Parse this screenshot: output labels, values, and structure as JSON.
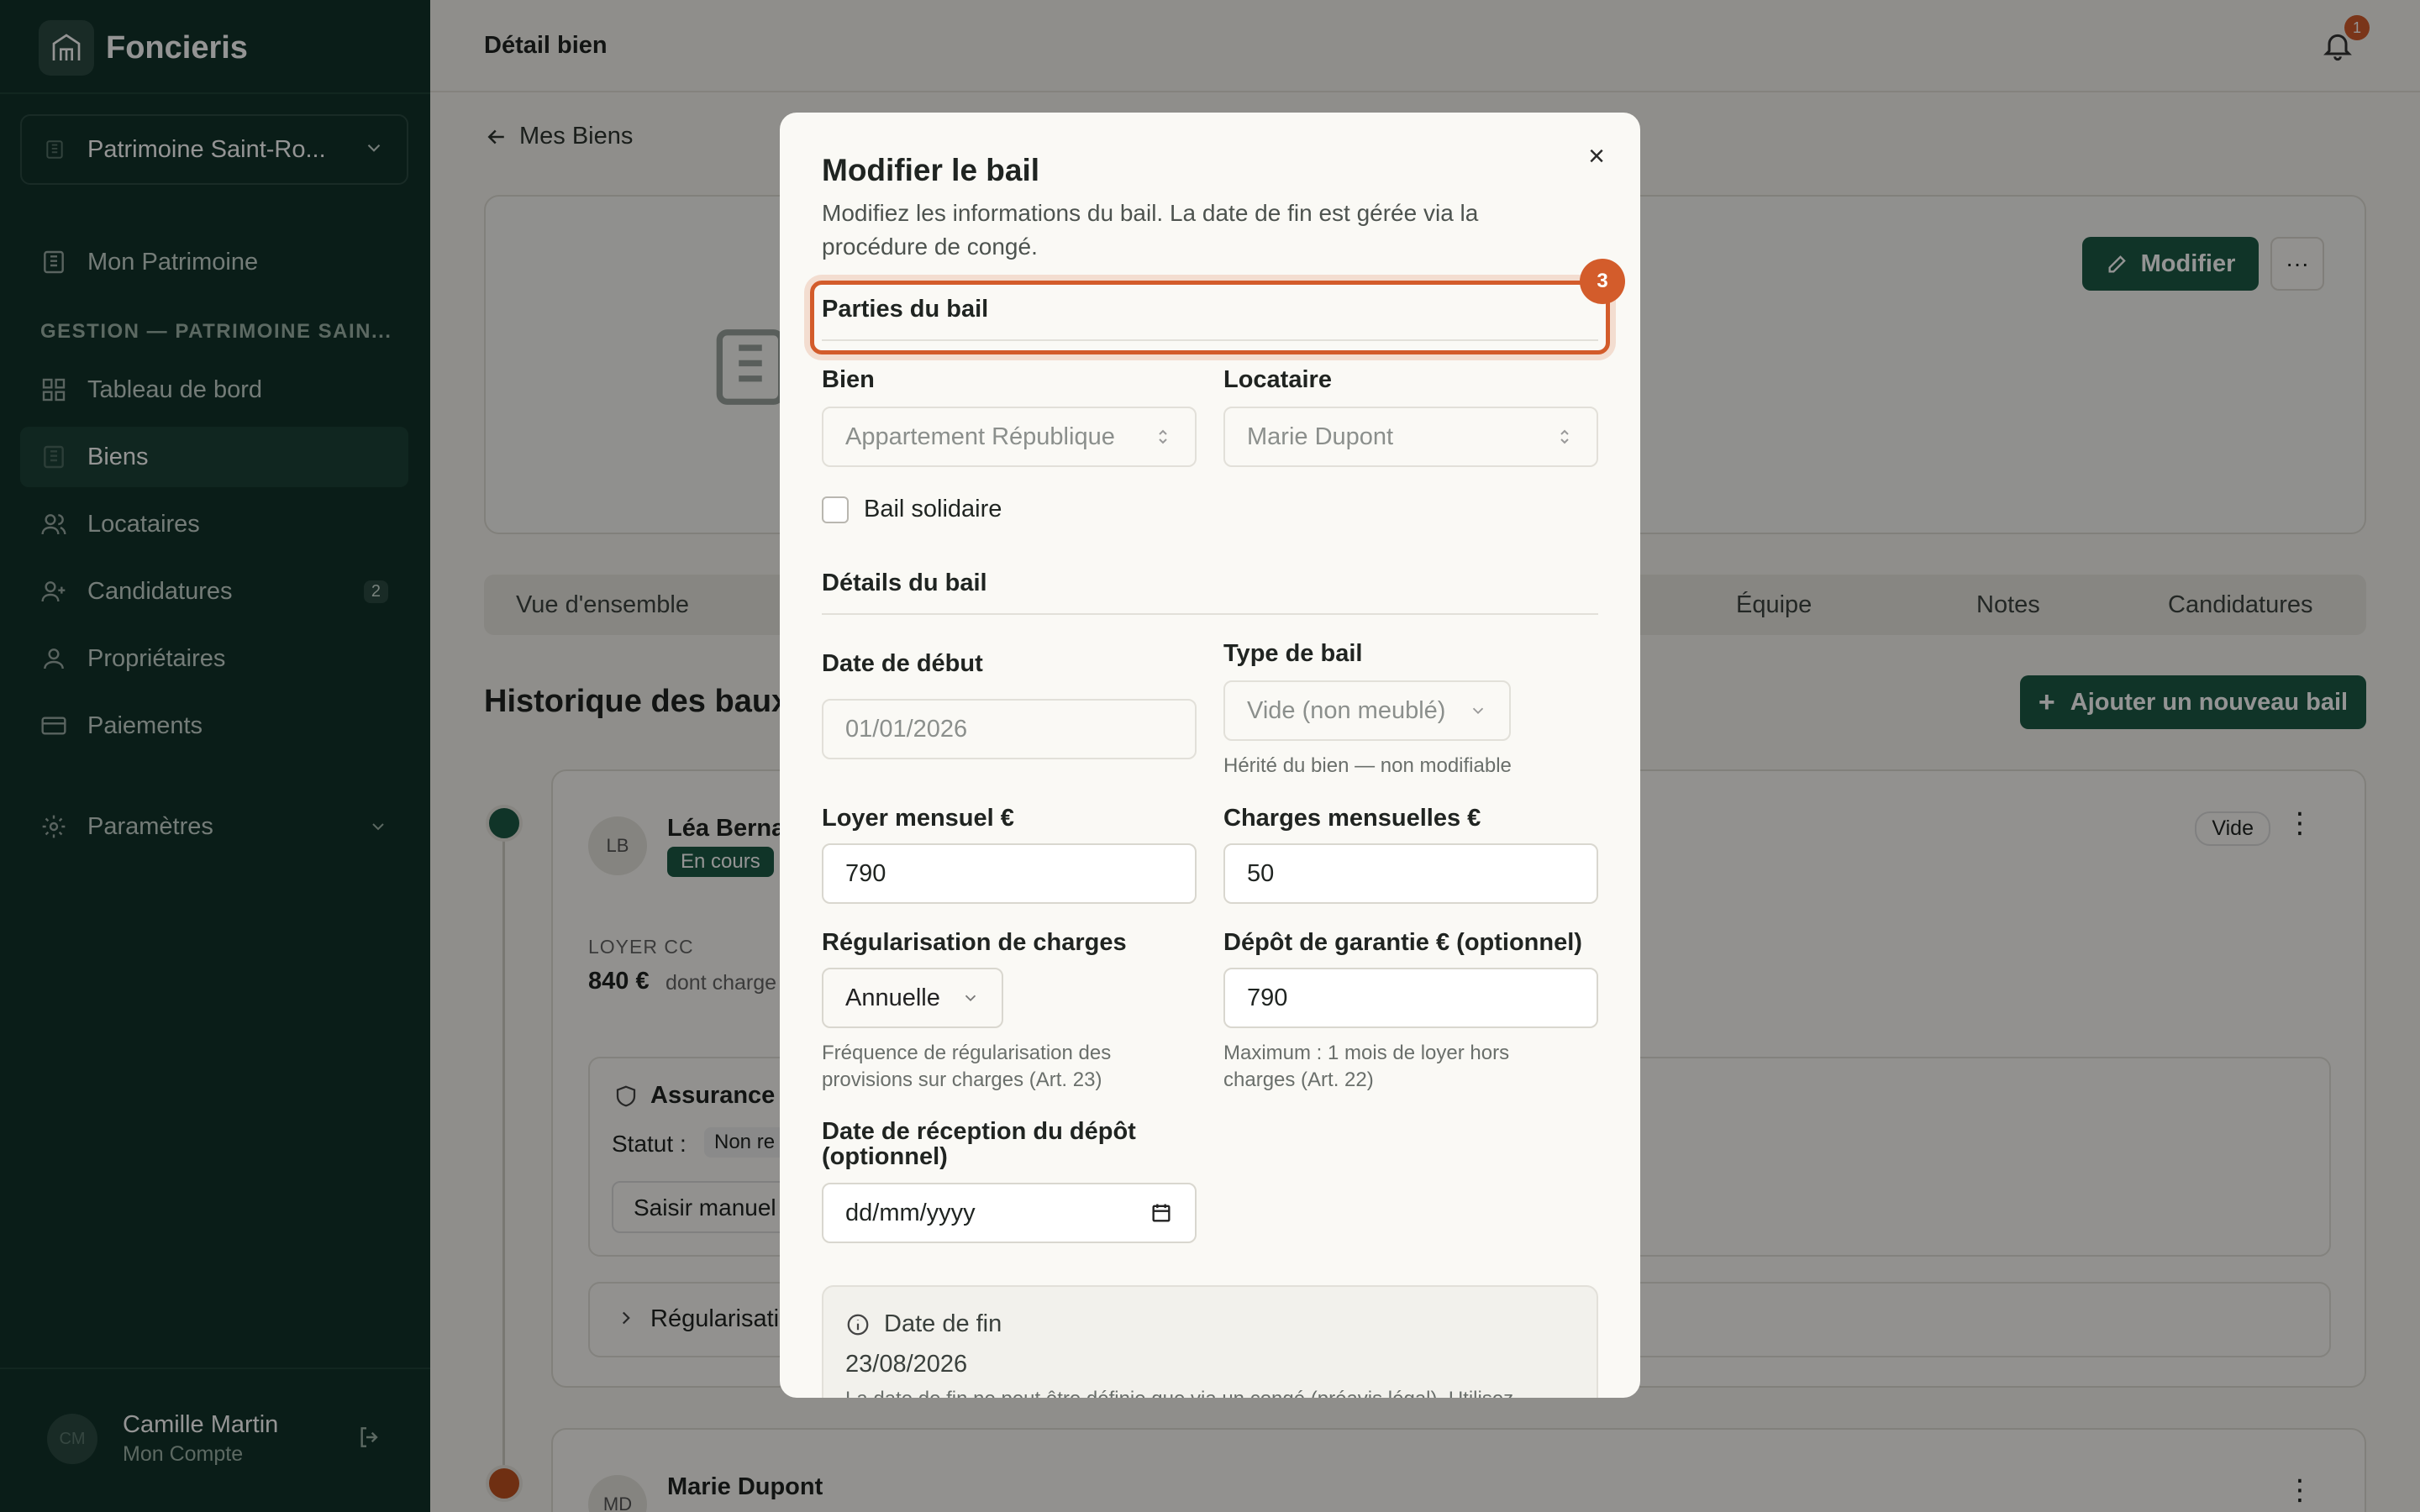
{
  "brand": {
    "name": "Foncieris"
  },
  "org": {
    "name": "Patrimoine Saint-Ro..."
  },
  "nav": {
    "mon_patrimoine": "Mon Patrimoine",
    "section_label": "GESTION — PATRIMOINE SAIN...",
    "items": [
      {
        "label": "Tableau de bord",
        "active": false
      },
      {
        "label": "Biens",
        "active": true
      },
      {
        "label": "Locataires",
        "active": false
      },
      {
        "label": "Candidatures",
        "active": false,
        "badge": "2"
      },
      {
        "label": "Propriétaires",
        "active": false
      },
      {
        "label": "Paiements",
        "active": false
      }
    ],
    "settings": "Paramètres"
  },
  "user": {
    "initials": "CM",
    "name": "Camille Martin",
    "sub": "Mon Compte"
  },
  "topbar": {
    "title": "Détail bien",
    "notifications": "1"
  },
  "page": {
    "back_label": "Mes Biens",
    "modifier_label": "Modifier",
    "more_label": "···",
    "tabs": [
      "Vue d'ensemble",
      "Équipe",
      "Notes",
      "Candidatures"
    ],
    "history_title": "Historique des baux",
    "add_lease_label": "Ajouter un nouveau bail",
    "lease1": {
      "initials": "LB",
      "tenant": "Léa Berna",
      "status": "En cours",
      "type_badge": "Vide",
      "rent_label": "LOYER CC",
      "rent_value": "840 €",
      "rent_note": "dont charge",
      "insurance_label": "Assurance",
      "status_label": "Statut :",
      "status_value": "Non re",
      "manual_btn": "Saisir manuel",
      "regularisation": "Régularisati"
    },
    "lease2": {
      "initials": "MD",
      "tenant": "Marie Dupont"
    }
  },
  "modal": {
    "title": "Modifier le bail",
    "description": "Modifiez les informations du bail. La date de fin est gérée via la procédure de congé.",
    "step_badge": "3",
    "section_parties": "Parties du bail",
    "bien_label": "Bien",
    "bien_value": "Appartement République",
    "locataire_label": "Locataire",
    "locataire_value": "Marie Dupont",
    "bail_solidaire": "Bail solidaire",
    "section_details": "Détails du bail",
    "date_debut_label": "Date de début",
    "date_debut_value": "01/01/2026",
    "type_bail_label": "Type de bail",
    "type_bail_value": "Vide (non meublé)",
    "type_bail_help": "Hérité du bien — non modifiable",
    "loyer_label": "Loyer mensuel €",
    "loyer_value": "790",
    "charges_label": "Charges mensuelles €",
    "charges_value": "50",
    "regul_label": "Régularisation de charges",
    "regul_value": "Annuelle",
    "regul_help": "Fréquence de régularisation des provisions sur charges (Art. 23)",
    "depot_label": "Dépôt de garantie € (optionnel)",
    "depot_value": "790",
    "depot_help": "Maximum : 1 mois de loyer hors charges (Art. 22)",
    "reception_label": "Date de réception du dépôt (optionnel)",
    "reception_placeholder": "dd/mm/yyyy",
    "fin_title": "Date de fin",
    "fin_value": "23/08/2026",
    "fin_note": "La date de fin ne peut être définie que via un congé (préavis légal). Utilisez"
  },
  "colors": {
    "sidebar": "#12322a",
    "accent": "#1d5a45",
    "highlight": "#d35c2b"
  }
}
